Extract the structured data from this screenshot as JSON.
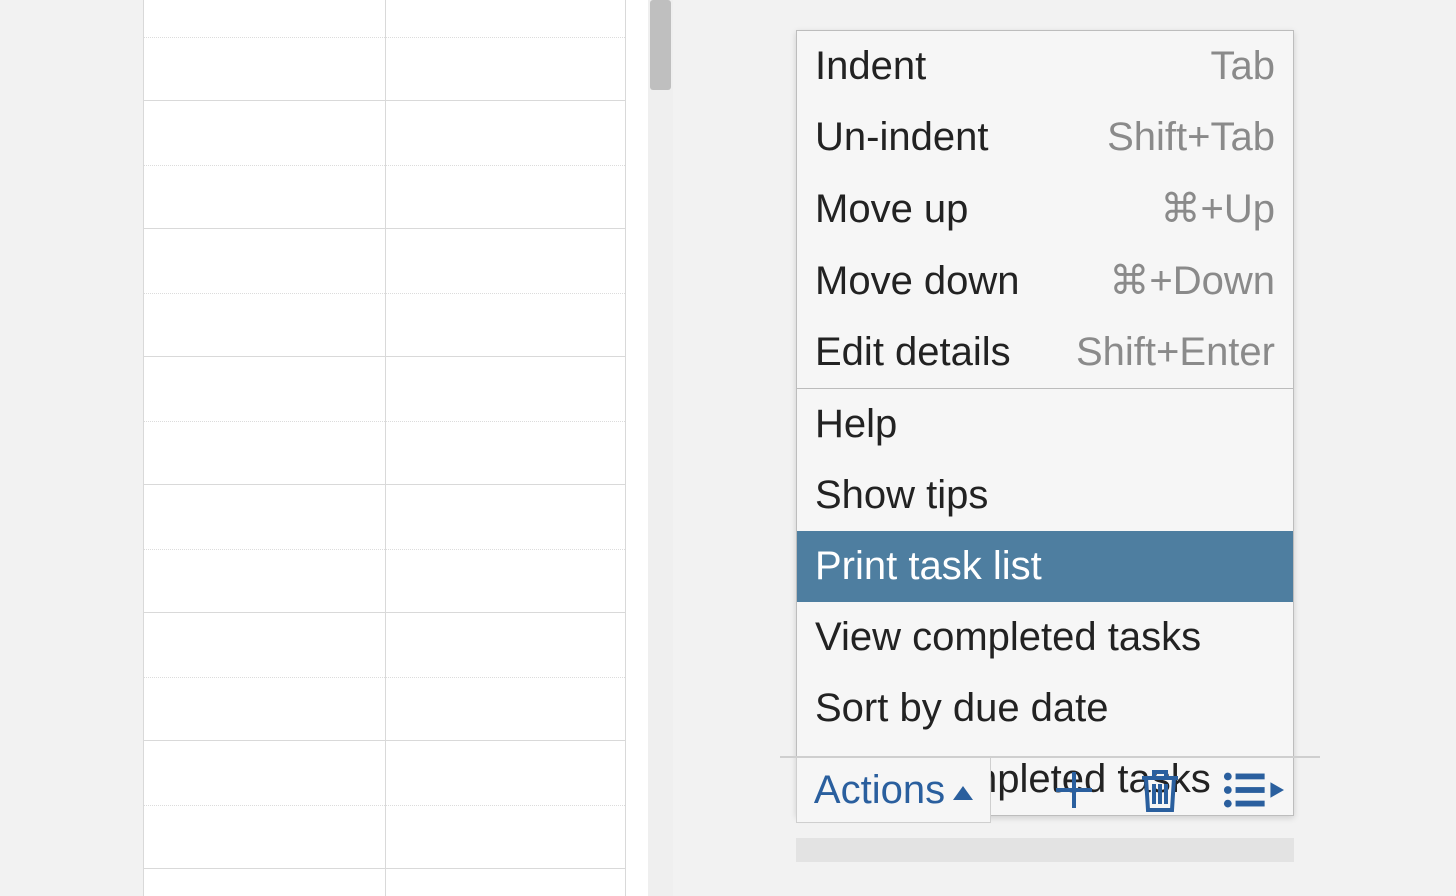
{
  "menu": {
    "section_a": [
      {
        "label": "Indent",
        "shortcut": "Tab"
      },
      {
        "label": "Un-indent",
        "shortcut": "Shift+Tab"
      },
      {
        "label": "Move up",
        "shortcut": "⌘+Up"
      },
      {
        "label": "Move down",
        "shortcut": "⌘+Down"
      },
      {
        "label": "Edit details",
        "shortcut": "Shift+Enter"
      }
    ],
    "section_b": [
      {
        "label": "Help"
      },
      {
        "label": "Show tips"
      },
      {
        "label": "Print task list",
        "highlight": true
      },
      {
        "label": "View completed tasks"
      },
      {
        "label": "Sort by due date"
      },
      {
        "label": "Clear completed tasks"
      }
    ]
  },
  "toolbar": {
    "actions_label": "Actions",
    "icons": {
      "add": "plus-icon",
      "delete": "trash-icon",
      "list": "list-menu-icon"
    }
  },
  "colors": {
    "menu_highlight": "#4e7ea0",
    "link": "#2a5f9e",
    "shortcut": "#8a8a8a"
  }
}
